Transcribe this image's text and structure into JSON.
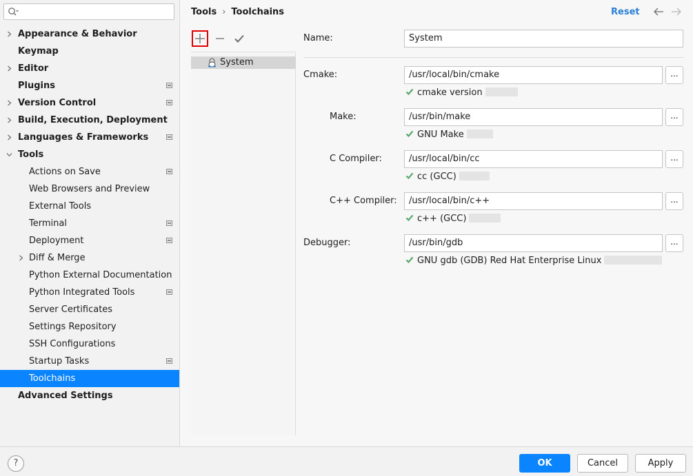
{
  "search": {
    "placeholder": ""
  },
  "sidebar": {
    "items": [
      {
        "label": "Appearance & Behavior"
      },
      {
        "label": "Keymap"
      },
      {
        "label": "Editor"
      },
      {
        "label": "Plugins"
      },
      {
        "label": "Version Control"
      },
      {
        "label": "Build, Execution, Deployment"
      },
      {
        "label": "Languages & Frameworks"
      },
      {
        "label": "Tools"
      },
      {
        "label": "Actions on Save"
      },
      {
        "label": "Web Browsers and Preview"
      },
      {
        "label": "External Tools"
      },
      {
        "label": "Terminal"
      },
      {
        "label": "Deployment"
      },
      {
        "label": "Diff & Merge"
      },
      {
        "label": "Python External Documentation"
      },
      {
        "label": "Python Integrated Tools"
      },
      {
        "label": "Server Certificates"
      },
      {
        "label": "Settings Repository"
      },
      {
        "label": "SSH Configurations"
      },
      {
        "label": "Startup Tasks"
      },
      {
        "label": "Toolchains"
      },
      {
        "label": "Advanced Settings"
      }
    ]
  },
  "header": {
    "breadcrumb_parent": "Tools",
    "breadcrumb_sep": "›",
    "breadcrumb_current": "Toolchains",
    "reset_label": "Reset"
  },
  "toolchains": {
    "items": [
      {
        "label": "System"
      }
    ]
  },
  "form": {
    "name_label": "Name:",
    "name_value": "System",
    "cmake_label": "Cmake:",
    "cmake_value": "/usr/local/bin/cmake",
    "cmake_status": "cmake version",
    "make_label": "Make:",
    "make_value": "/usr/bin/make",
    "make_status": "GNU Make",
    "c_label": "C Compiler:",
    "c_value": "/usr/local/bin/cc",
    "c_status": "cc (GCC)",
    "cpp_label": "C++ Compiler:",
    "cpp_value": "/usr/local/bin/c++",
    "cpp_status": "c++ (GCC)",
    "debugger_label": "Debugger:",
    "debugger_value": "/usr/bin/gdb",
    "debugger_status": "GNU gdb (GDB) Red Hat Enterprise Linux",
    "browse_label": "..."
  },
  "footer": {
    "help_label": "?",
    "ok_label": "OK",
    "cancel_label": "Cancel",
    "apply_label": "Apply"
  },
  "colors": {
    "accent": "#0a84ff",
    "link": "#2a7fd6",
    "success": "#59a869",
    "highlight_box": "#e00000"
  },
  "icons": [
    "search-icon",
    "chevron-right-icon",
    "chevron-down-icon",
    "settings-badge-icon",
    "arrow-left-icon",
    "arrow-right-icon",
    "add-icon",
    "remove-icon",
    "check-icon",
    "linux-icon",
    "success-check-icon",
    "help-icon"
  ]
}
